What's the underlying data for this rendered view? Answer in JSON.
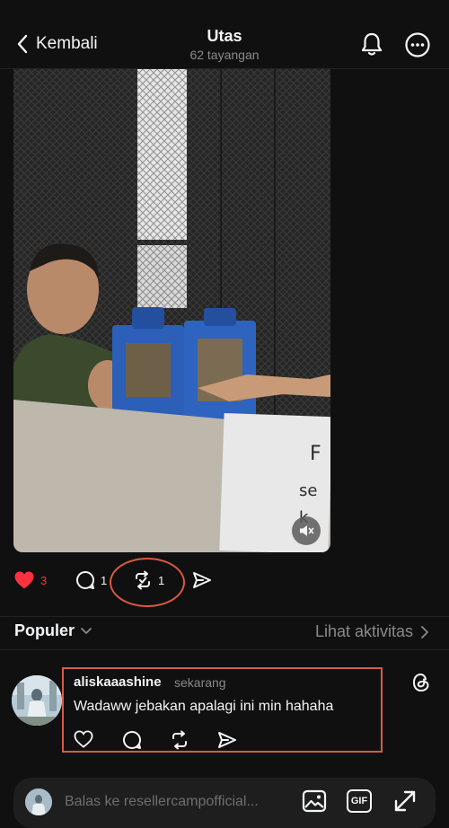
{
  "header": {
    "back_label": "Kembali",
    "title": "Utas",
    "subtitle": "62 tayangan"
  },
  "video": {
    "muted": true,
    "sign_text": "F\nse\nk"
  },
  "actions": {
    "like_count": "3",
    "comment_count": "1",
    "repost_count": "1",
    "liked": true
  },
  "sort_bar": {
    "label": "Populer",
    "activity_link": "Lihat aktivitas"
  },
  "reply": {
    "username": "aliskaaashine",
    "timestamp": "sekarang",
    "text": "Wadaww jebakan apalagi ini min hahaha"
  },
  "composer": {
    "placeholder": "Balas ke resellercampofficial..."
  },
  "colors": {
    "background": "#101010",
    "like": "#ff3040",
    "highlight": "#d85a43",
    "muted_text": "#8a8a8a"
  },
  "icons": [
    "chevron-left-icon",
    "bell-icon",
    "more-icon",
    "heart-icon",
    "comment-icon",
    "repost-icon",
    "share-icon",
    "threads-icon",
    "image-icon",
    "gif-icon",
    "expand-icon",
    "mute-icon",
    "chevron-down-icon",
    "chevron-right-icon"
  ]
}
